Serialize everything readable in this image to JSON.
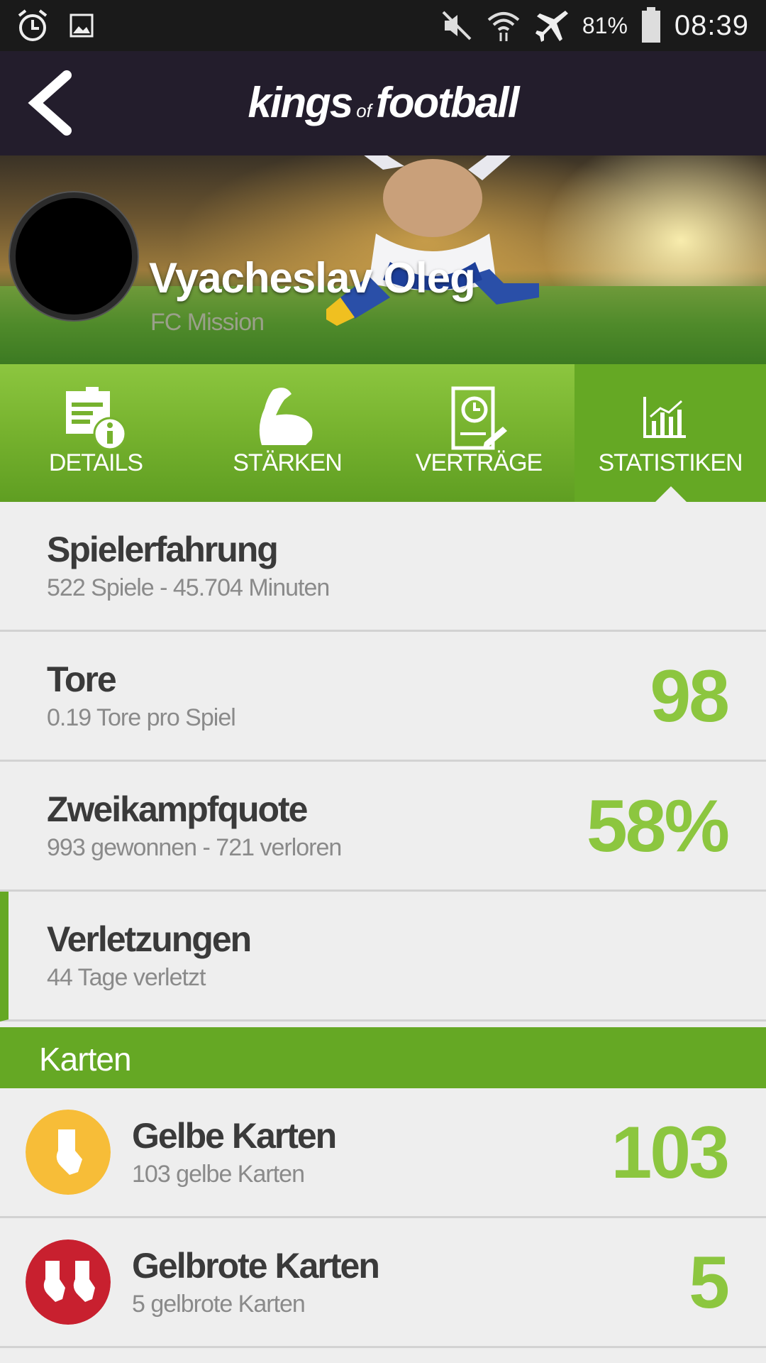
{
  "status_bar": {
    "battery_percent": "81%",
    "time": "08:39"
  },
  "app_bar": {
    "logo_part1": "kings",
    "logo_part2": "of",
    "logo_part3": "football"
  },
  "profile": {
    "name": "Vyacheslav Oleg",
    "club": "FC Mission"
  },
  "tabs": [
    {
      "label": "DETAILS",
      "icon": "details-icon",
      "active": false
    },
    {
      "label": "STÄRKEN",
      "icon": "strength-icon",
      "active": false
    },
    {
      "label": "VERTRÄGE",
      "icon": "contract-icon",
      "active": false
    },
    {
      "label": "STATISTIKEN",
      "icon": "statistics-icon",
      "active": true
    }
  ],
  "stats": {
    "experience": {
      "title": "Spielerfahrung",
      "sub": "522 Spiele - 45.704 Minuten"
    },
    "goals": {
      "title": "Tore",
      "sub": "0.19 Tore pro Spiel",
      "value": "98"
    },
    "duels": {
      "title": "Zweikampfquote",
      "sub": "993 gewonnen - 721 verloren",
      "value": "58%"
    },
    "injuries": {
      "title": "Verletzungen",
      "sub": "44 Tage verletzt"
    }
  },
  "cards_section": {
    "title": "Karten",
    "yellow": {
      "title": "Gelbe Karten",
      "sub": "103 gelbe Karten",
      "value": "103",
      "color": "#f7bd38"
    },
    "yellow_red": {
      "title": "Gelbrote Karten",
      "sub": "5 gelbrote Karten",
      "value": "5",
      "color": "#c8202f"
    }
  },
  "colors": {
    "accent_green": "#8cc63f",
    "dark_green": "#65a824",
    "app_bar": "#231d2c"
  }
}
